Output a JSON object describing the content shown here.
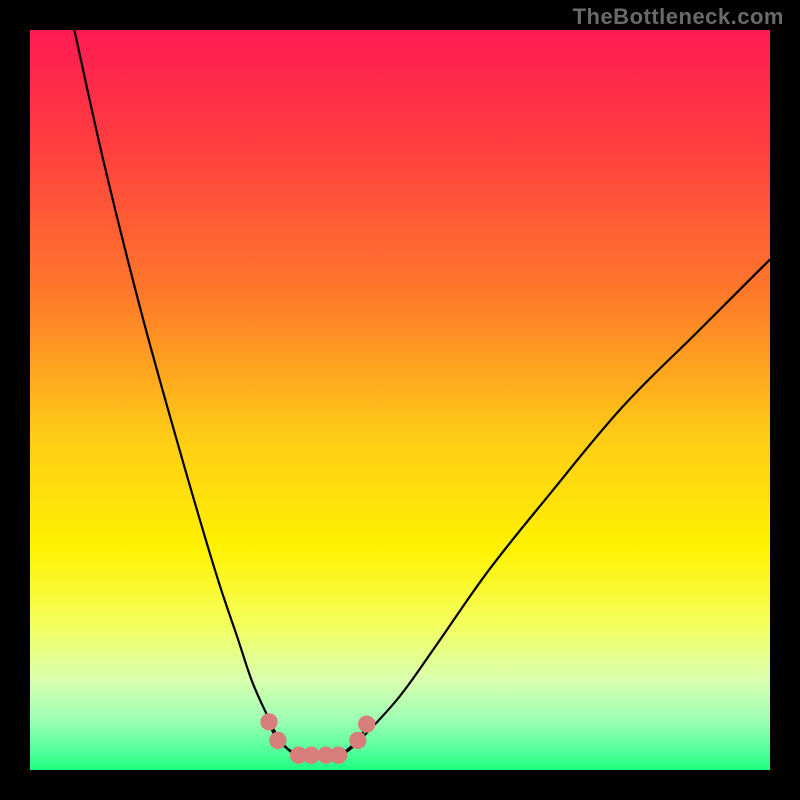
{
  "watermark": "TheBottleneck.com",
  "colors": {
    "frame": "#000000",
    "curve": "#000000",
    "marker": "#d77d7a",
    "watermark_text": "#6a6a6a"
  },
  "gradient_stops": [
    {
      "pct": 0,
      "color": "#ff1a52"
    },
    {
      "pct": 16,
      "color": "#ff3f3f"
    },
    {
      "pct": 36,
      "color": "#ff7a2a"
    },
    {
      "pct": 55,
      "color": "#ffcc16"
    },
    {
      "pct": 70,
      "color": "#fff200"
    },
    {
      "pct": 80,
      "color": "#f5ff5a"
    },
    {
      "pct": 88,
      "color": "#d8ffb0"
    },
    {
      "pct": 93,
      "color": "#a0ffb5"
    },
    {
      "pct": 97,
      "color": "#5cff9e"
    },
    {
      "pct": 100,
      "color": "#1dff80"
    }
  ],
  "chart_data": {
    "type": "line",
    "title": "",
    "xlabel": "",
    "ylabel": "",
    "xlim": [
      0,
      100
    ],
    "ylim": [
      0,
      100
    ],
    "grid": false,
    "legend": false,
    "series": [
      {
        "name": "left-curve",
        "x": [
          6.0,
          10,
          15,
          20,
          25,
          28,
          30,
          32,
          33.5,
          35.5,
          37.5
        ],
        "y": [
          100,
          82,
          62,
          44,
          27,
          18,
          12,
          7.5,
          4.5,
          2.3,
          2.0
        ]
      },
      {
        "name": "right-curve",
        "x": [
          40.5,
          42.5,
          45,
          50,
          55,
          62,
          70,
          80,
          90,
          98,
          100
        ],
        "y": [
          2.0,
          2.3,
          4.5,
          10,
          17,
          27,
          37,
          49,
          59,
          67,
          69
        ]
      },
      {
        "name": "floor-segment",
        "x": [
          37.5,
          40.5
        ],
        "y": [
          2.0,
          2.0
        ]
      }
    ],
    "markers": {
      "name": "highlight-markers",
      "points": [
        {
          "x": 32.3,
          "y": 6.5
        },
        {
          "x": 33.5,
          "y": 4.0
        },
        {
          "x": 36.3,
          "y": 2.0
        },
        {
          "x": 38.0,
          "y": 2.0
        },
        {
          "x": 40.0,
          "y": 2.0
        },
        {
          "x": 41.7,
          "y": 2.0
        },
        {
          "x": 44.3,
          "y": 4.0
        },
        {
          "x": 45.5,
          "y": 6.2
        }
      ],
      "radius_data_units": 1.1
    }
  }
}
